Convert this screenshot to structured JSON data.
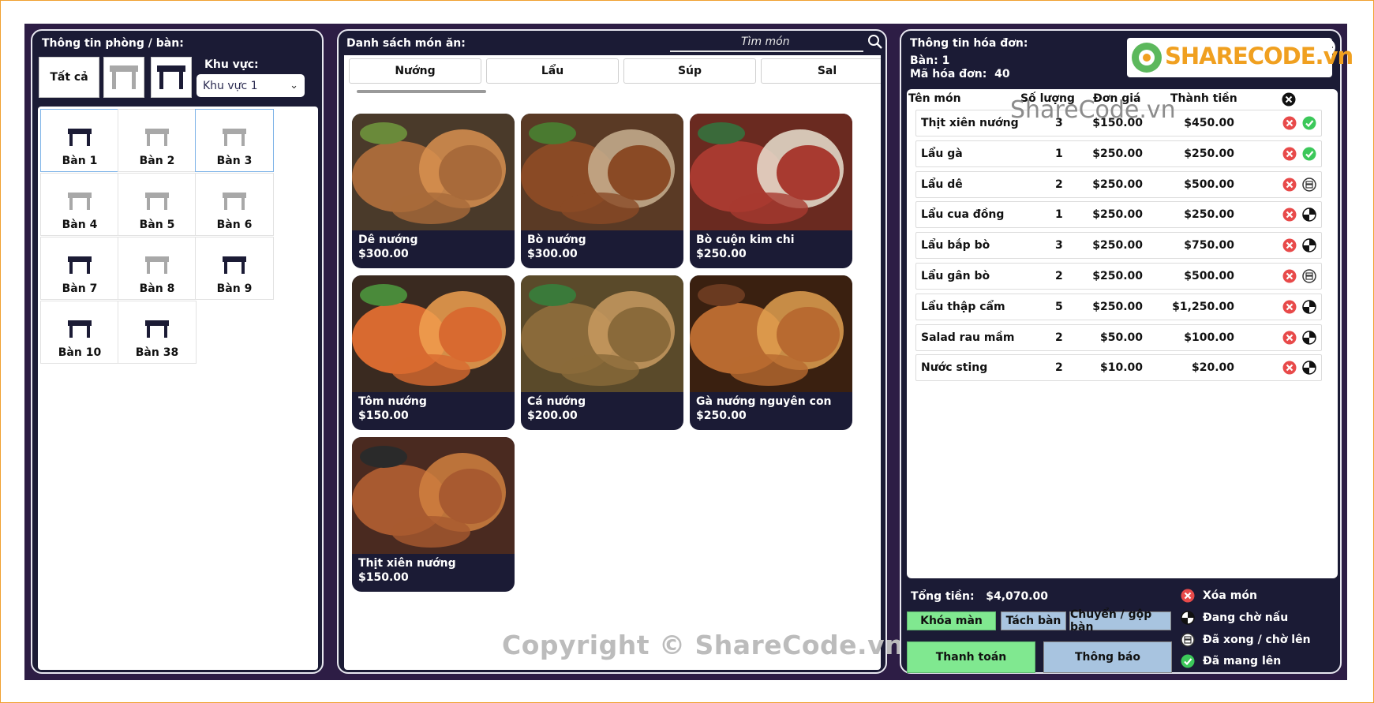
{
  "colors": {
    "app_bg": "#2d1d45",
    "panel_bg": "#1b1b35",
    "btn_green": "#80e890",
    "btn_blue": "#a8c4e0",
    "delete_red": "#e84a4a",
    "done_green": "#3cc85a"
  },
  "tables_panel": {
    "title": "Thông tin phòng / bàn:",
    "filter_all": "Tất cả",
    "filter_empty_icon": "empty-table-icon",
    "filter_occupied_icon": "occupied-table-icon",
    "area_label": "Khu vực:",
    "area_selected": "Khu vực 1",
    "tables": [
      {
        "name": "Bàn 1",
        "occupied": true
      },
      {
        "name": "Bàn 2",
        "occupied": false
      },
      {
        "name": "Bàn 3",
        "occupied": false
      },
      {
        "name": "Bàn 4",
        "occupied": false
      },
      {
        "name": "Bàn 5",
        "occupied": false
      },
      {
        "name": "Bàn 6",
        "occupied": false
      },
      {
        "name": "Bàn 7",
        "occupied": true
      },
      {
        "name": "Bàn 8",
        "occupied": false
      },
      {
        "name": "Bàn 9",
        "occupied": true
      },
      {
        "name": "Bàn 10",
        "occupied": true
      },
      {
        "name": "Bàn 38",
        "occupied": true
      }
    ]
  },
  "menu_panel": {
    "title": "Danh sách món ăn:",
    "search_placeholder": "Tìm món",
    "categories": [
      "Nướng",
      "Lẩu",
      "Súp",
      "Sal"
    ],
    "dishes": [
      {
        "name": "Dê nướng",
        "price": "$300.00"
      },
      {
        "name": "Bò nướng",
        "price": "$300.00"
      },
      {
        "name": "Bò cuộn kim chi",
        "price": "$250.00"
      },
      {
        "name": "Tôm nướng",
        "price": "$150.00"
      },
      {
        "name": "Cá nướng",
        "price": "$200.00"
      },
      {
        "name": "Gà nướng nguyên con",
        "price": "$250.00"
      },
      {
        "name": "Thịt xiên nướng",
        "price": "$150.00"
      }
    ],
    "copyright": "Copyright © ShareCode.vn"
  },
  "bill_panel": {
    "title": "Thông tin hóa đơn:",
    "table_label": "Bàn:",
    "table_value": "1",
    "bill_id_label": "Mã hóa đơn:",
    "bill_id_value": "40",
    "logo_text": "SHARECODE.vn",
    "watermark": "ShareCode.vn",
    "columns": [
      "Tên món",
      "Số lượng",
      "Đơn giá",
      "Thành tiền"
    ],
    "items": [
      {
        "name": "Thịt xiên nướng",
        "qty": "3",
        "unit": "$150.00",
        "total": "$450.00",
        "status": "done"
      },
      {
        "name": "Lẩu gà",
        "qty": "1",
        "unit": "$250.00",
        "total": "$250.00",
        "status": "done"
      },
      {
        "name": "Lẩu dê",
        "qty": "2",
        "unit": "$250.00",
        "total": "$500.00",
        "status": "ready"
      },
      {
        "name": "Lẩu cua đồng",
        "qty": "1",
        "unit": "$250.00",
        "total": "$250.00",
        "status": "waiting"
      },
      {
        "name": "Lẩu bắp bò",
        "qty": "3",
        "unit": "$250.00",
        "total": "$750.00",
        "status": "waiting"
      },
      {
        "name": "Lẩu gân bò",
        "qty": "2",
        "unit": "$250.00",
        "total": "$500.00",
        "status": "ready"
      },
      {
        "name": "Lẩu thập cẩm",
        "qty": "5",
        "unit": "$250.00",
        "total": "$1,250.00",
        "status": "waiting"
      },
      {
        "name": "Salad rau mầm",
        "qty": "2",
        "unit": "$50.00",
        "total": "$100.00",
        "status": "waiting"
      },
      {
        "name": "Nước sting",
        "qty": "2",
        "unit": "$10.00",
        "total": "$20.00",
        "status": "waiting"
      }
    ],
    "total_label": "Tổng tiền:",
    "total_value": "$4,070.00",
    "buttons": {
      "lock": "Khóa màn",
      "split": "Tách bàn",
      "move": "Chuyển / gộp bàn",
      "pay": "Thanh toán",
      "notify": "Thông báo"
    },
    "legend": {
      "delete": "Xóa món",
      "waiting": "Đang chờ nấu",
      "ready": "Đã xong / chờ lên",
      "served": "Đã mang lên"
    }
  }
}
